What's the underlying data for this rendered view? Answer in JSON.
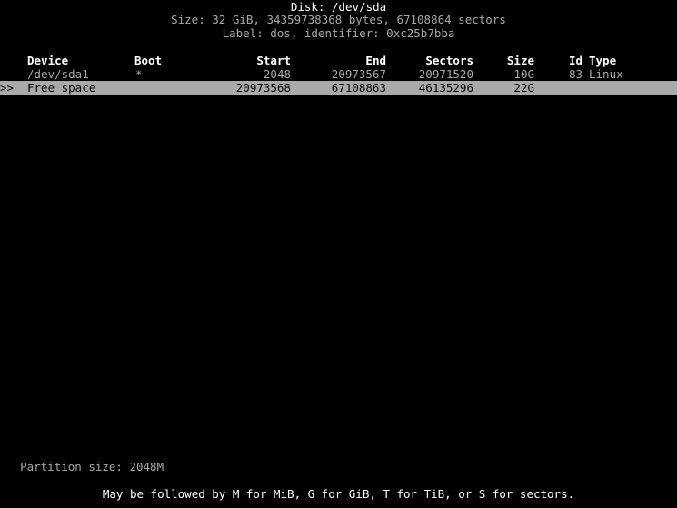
{
  "disk": {
    "title": "Disk: /dev/sda",
    "size_line": "Size: 32 GiB, 34359738368 bytes, 67108864 sectors",
    "label_line": "Label: dos, identifier: 0xc25b7bba"
  },
  "table": {
    "headers": {
      "device": "Device",
      "boot": "Boot",
      "start": "Start",
      "end": "End",
      "sectors": "Sectors",
      "size": "Size",
      "id": "Id",
      "type": "Type"
    },
    "rows": [
      {
        "marker": "",
        "device": "/dev/sda1",
        "boot": "*",
        "start": "2048",
        "end": "20973567",
        "sectors": "20971520",
        "size": "10G",
        "id": "83",
        "type": "Linux",
        "selected": false
      },
      {
        "marker": ">>",
        "device": "Free space",
        "boot": "",
        "start": "20973568",
        "end": "67108863",
        "sectors": "46135296",
        "size": "22G",
        "id": "",
        "type": "",
        "selected": true
      }
    ]
  },
  "prompt": {
    "label": "Partition size:",
    "value": "2048M"
  },
  "hint": "May be followed by M for MiB, G for GiB, T for TiB, or S for sectors.",
  "colors": {
    "background": "#000000",
    "text": "#a8a8a8",
    "bright_text": "#ffffff",
    "selection_bg": "#aaaaaa",
    "selection_text": "#000000"
  }
}
